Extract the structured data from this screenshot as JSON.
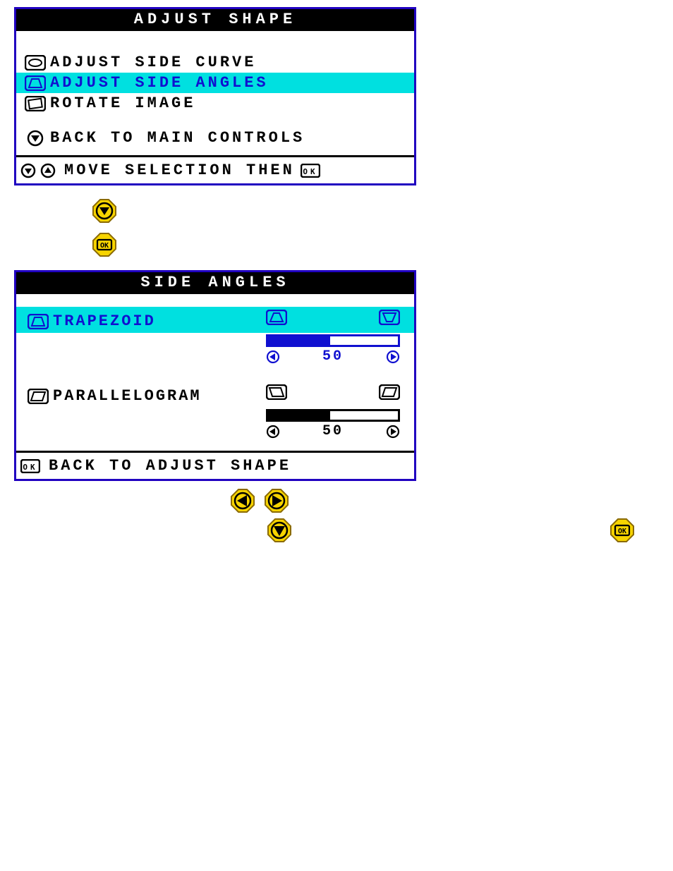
{
  "adjust_shape": {
    "title": "ADJUST SHAPE",
    "items": [
      {
        "icon": "pincushion-icon",
        "label": "ADJUST SIDE CURVE",
        "selected": false
      },
      {
        "icon": "trapezoid-icon",
        "label": "ADJUST SIDE ANGLES",
        "selected": true
      },
      {
        "icon": "rotate-icon",
        "label": "ROTATE IMAGE",
        "selected": false
      }
    ],
    "back_label": "BACK TO MAIN CONTROLS",
    "footer": "MOVE SELECTION THEN"
  },
  "side_angles": {
    "title": "SIDE ANGLES",
    "rows": [
      {
        "icon": "trapezoid-icon",
        "label": "TRAPEZOID",
        "value": "50",
        "fill_pct": 48,
        "selected": true,
        "min_icon": "trap-narrow-top-icon",
        "max_icon": "trap-wide-top-icon"
      },
      {
        "icon": "parallelogram-icon",
        "label": "PARALLELOGRAM",
        "value": "50",
        "fill_pct": 48,
        "selected": false,
        "min_icon": "para-left-icon",
        "max_icon": "para-right-icon"
      }
    ],
    "footer": "BACK TO ADJUST SHAPE"
  },
  "colors": {
    "highlight": "#00e0e0",
    "accent": "#1010d0",
    "button": "#f7d400"
  }
}
